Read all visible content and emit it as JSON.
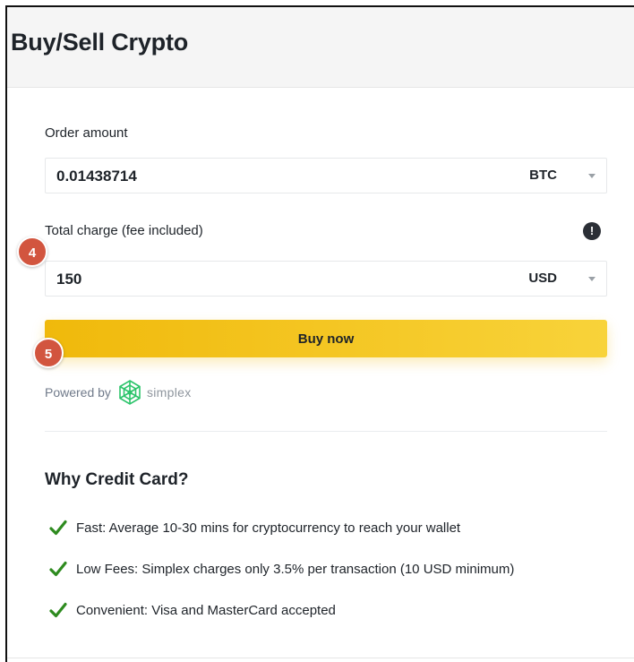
{
  "header": {
    "title": "Buy/Sell Crypto"
  },
  "order": {
    "amount_label": "Order amount",
    "amount_value": "0.01438714",
    "amount_currency": "BTC",
    "charge_label": "Total charge (fee included)",
    "charge_value": "150",
    "charge_currency": "USD",
    "info_icon_glyph": "!"
  },
  "actions": {
    "buy_label": "Buy now"
  },
  "steps": {
    "step4": "4",
    "step5": "5"
  },
  "powered": {
    "prefix": "Powered by",
    "brand": "simplex"
  },
  "why": {
    "title": "Why Credit Card?",
    "items": [
      "Fast: Average 10-30 mins for cryptocurrency to reach your wallet",
      "Low Fees: Simplex charges only 3.5% per transaction (10 USD minimum)",
      "Convenient: Visa and MasterCard accepted"
    ]
  },
  "colors": {
    "accent": "#F0B90B",
    "badge": "#D2553F",
    "check": "#2E8B1F",
    "simplex_logo": "#2CC46B"
  },
  "icons": {
    "info": "exclamation-circle-icon",
    "check": "check-icon",
    "caret": "chevron-down-icon",
    "logo": "simplex-logo-icon"
  }
}
